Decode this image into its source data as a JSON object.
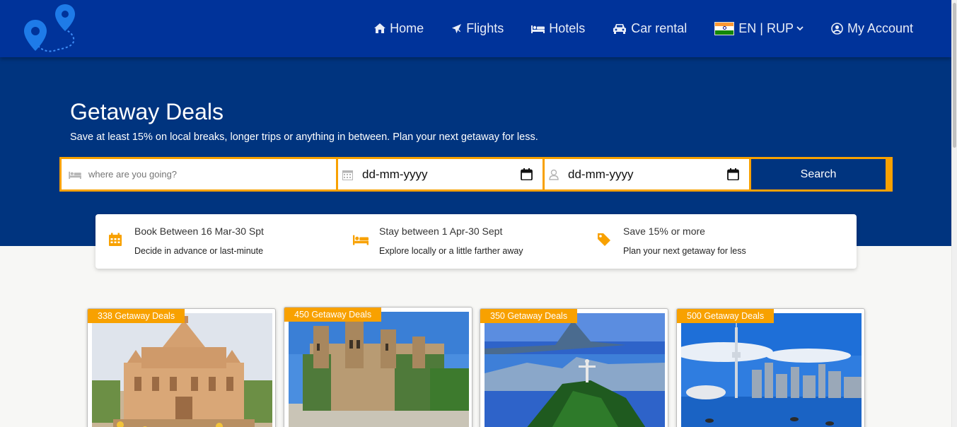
{
  "nav": {
    "items": [
      {
        "label": "Home",
        "icon": "home-icon"
      },
      {
        "label": "Flights",
        "icon": "plane-icon"
      },
      {
        "label": "Hotels",
        "icon": "bed-icon"
      },
      {
        "label": "Car rental",
        "icon": "car-icon"
      },
      {
        "label": "EN | RUP",
        "icon": "india-flag-icon"
      },
      {
        "label": "My Account",
        "icon": "user-circle-icon"
      }
    ]
  },
  "hero": {
    "title": "Getaway Deals",
    "subtitle": "Save at least 15% on local breaks, longer trips or anything in between. Plan your next getaway for less."
  },
  "search": {
    "destination_placeholder": "where are you going?",
    "checkin_value": "dd-mm-yyyy",
    "checkout_value": "dd-mm-yyyy",
    "button_label": "Search"
  },
  "info": [
    {
      "title": "Book Between 16 Mar-30 Spt",
      "sub": "Decide in advance or last-minute",
      "icon": "calendar-icon"
    },
    {
      "title": "Stay between 1 Apr-30 Sept",
      "sub": "Explore locally or a little farther away",
      "icon": "bed-icon"
    },
    {
      "title": "Save 15% or more",
      "sub": "Plan your next getaway for less",
      "icon": "tag-icon"
    }
  ],
  "deals": [
    {
      "badge": "338 Getaway Deals"
    },
    {
      "badge": "450 Getaway Deals"
    },
    {
      "badge": "350 Getaway Deals"
    },
    {
      "badge": "500 Getaway Deals"
    }
  ],
  "colors": {
    "nav": "#00339a",
    "hero": "#00347f",
    "accent": "#f8a100"
  }
}
